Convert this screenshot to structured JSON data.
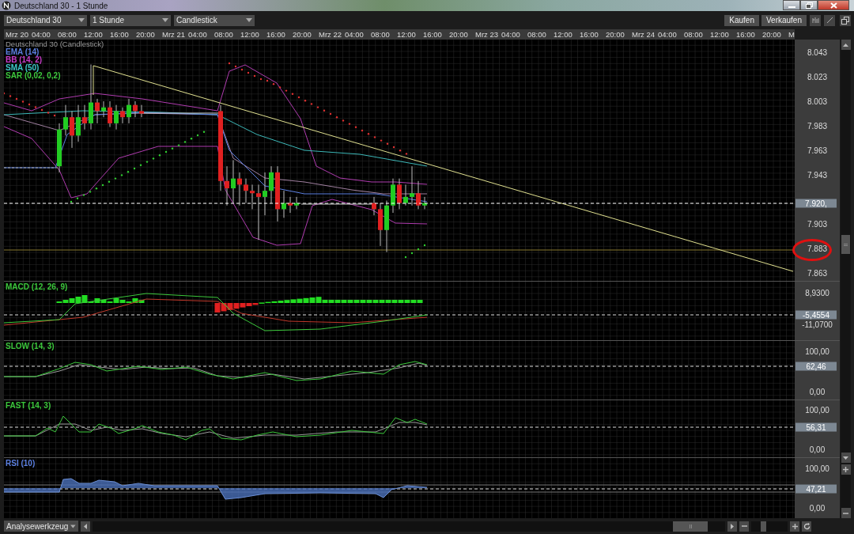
{
  "window": {
    "title": "Deutschland 30 - 1 Stunde"
  },
  "toolbar": {
    "dropdowns": [
      "Deutschland 30",
      "1 Stunde",
      "Candlestick"
    ],
    "buttons": [
      "Kaufen",
      "Verkaufen"
    ]
  },
  "time_axis": [
    "Mrz 20",
    "04:00",
    "08:00",
    "12:00",
    "16:00",
    "20:00",
    "Mrz 21",
    "04:00",
    "08:00",
    "12:00",
    "16:00",
    "20:00",
    "Mrz 22",
    "04:00",
    "08:00",
    "12:00",
    "16:00",
    "20:00",
    "Mrz 23",
    "04:00",
    "08:00",
    "12:00",
    "16:00",
    "20:00",
    "Mrz 24",
    "04:00",
    "08:00",
    "12:00",
    "16:00",
    "20:00",
    "M"
  ],
  "price_panel": {
    "title": "Deutschland 30 (Candlestick)",
    "indicators": [
      {
        "label": "EMA (14)",
        "color": "#5b7fe0"
      },
      {
        "label": "BB (14, 2)",
        "color": "#c83cc8"
      },
      {
        "label": "SMA (50)",
        "color": "#3cc8c8"
      },
      {
        "label": "SAR (0,02, 0,2)",
        "color": "#3cc83c"
      }
    ],
    "ticks": [
      {
        "label": "8.043",
        "circled": false
      },
      {
        "label": "8.023",
        "circled": false
      },
      {
        "label": "8.003",
        "circled": false
      },
      {
        "label": "7.983",
        "circled": false
      },
      {
        "label": "7.963",
        "circled": false
      },
      {
        "label": "7.943",
        "circled": false
      },
      {
        "label": "7.903",
        "circled": false
      },
      {
        "label": "7.883",
        "circled": true
      },
      {
        "label": "7.863",
        "circled": false
      }
    ],
    "current_value": "7.920,"
  },
  "indicator_panels": [
    {
      "title": "MACD (12, 26, 9)",
      "color": "#3cc83c",
      "ticks": [
        "8,9300",
        "-11,0700"
      ],
      "current_value": "-5,4554"
    },
    {
      "title": "SLOW (14, 3)",
      "color": "#3cc83c",
      "ticks": [
        "100,00",
        "0,00"
      ],
      "current_value": "62,46"
    },
    {
      "title": "FAST (14, 3)",
      "color": "#3cc83c",
      "ticks": [
        "100,00",
        "0,00"
      ],
      "current_value": "56,31"
    },
    {
      "title": "RSI (10)",
      "color": "#5b7fe0",
      "ticks": [
        "100,00",
        "0,00"
      ],
      "current_value": "47,21"
    }
  ],
  "bottom_bar": {
    "tool_menu": "Analysewerkzeug",
    "zoom": {
      "level": 0.3
    }
  }
}
